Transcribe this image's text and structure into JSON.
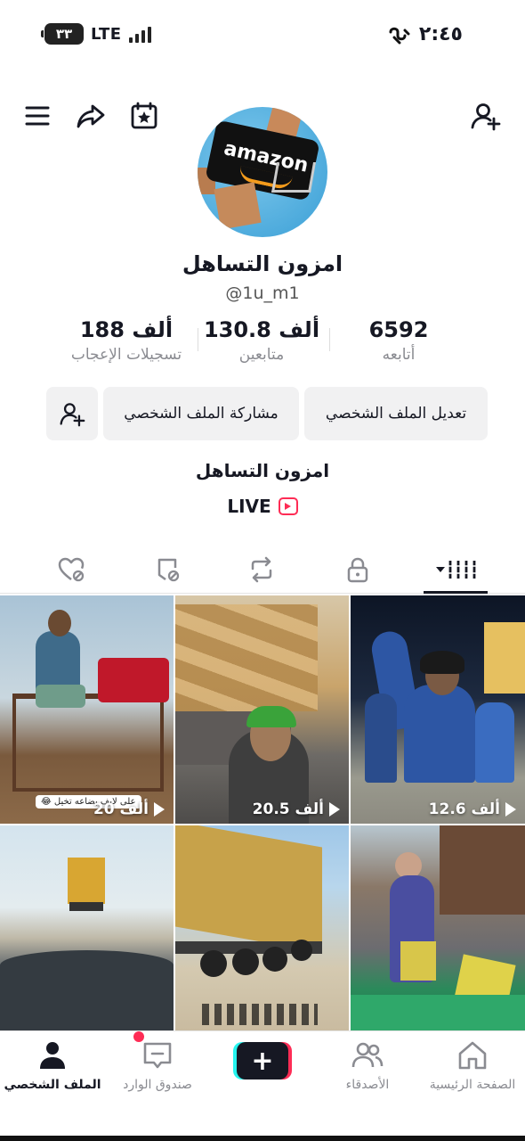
{
  "status_bar": {
    "battery": "٣٣",
    "network": "LTE",
    "time": "٢:٤٥"
  },
  "top_nav": {
    "icons": [
      "menu-icon",
      "share-arrow-icon",
      "calendar-star-icon",
      "add-user-icon"
    ]
  },
  "profile": {
    "avatar_text": "amazon",
    "display_name": "امزون التساهل",
    "username": "@1u_m1",
    "bio": "امزون التساهل",
    "live_label": "LIVE"
  },
  "stats": {
    "following": {
      "value": "6592",
      "label": "أتابعه"
    },
    "followers": {
      "value": "130.8 ألف",
      "label": "متابعين"
    },
    "likes": {
      "value": "188 ألف",
      "label": "تسجيلات الإعجاب"
    }
  },
  "buttons": {
    "edit_profile": "تعديل الملف الشخصي",
    "share_profile": "مشاركة الملف الشخصي"
  },
  "tabs": [
    {
      "name": "videos",
      "icon": "grid-bars-icon",
      "active": true
    },
    {
      "name": "private",
      "icon": "lock-icon",
      "active": false
    },
    {
      "name": "reposts",
      "icon": "repost-icon",
      "active": false
    },
    {
      "name": "favorites",
      "icon": "bookmark-hidden-icon",
      "active": false
    },
    {
      "name": "liked",
      "icon": "heart-hidden-icon",
      "active": false
    }
  ],
  "videos": [
    {
      "views": "20 ألف",
      "caption": "😂 على لايف بضاعه تخيل",
      "colors": [
        "#a9c3d6",
        "#7a5a3d"
      ]
    },
    {
      "views": "20.5 ألف",
      "colors": [
        "#c9a46b",
        "#6d6a66"
      ]
    },
    {
      "views": "12.6 ألف",
      "colors": [
        "#0d1525",
        "#2d56a4"
      ]
    },
    {
      "views": "",
      "colors": [
        "#d4e4ee",
        "#4b5158"
      ]
    },
    {
      "views": "",
      "colors": [
        "#9fc7e8",
        "#c7a24a"
      ]
    },
    {
      "views": "",
      "colors": [
        "#b7c6cf",
        "#2a8a5a"
      ]
    }
  ],
  "bottom_nav": {
    "home": "الصفحة الرئيسية",
    "friends": "الأصدقاء",
    "create": "+",
    "inbox": "صندوق الوارد",
    "profile": "الملف الشخصي"
  },
  "colors": {
    "accent_red": "#fe2c55",
    "accent_cyan": "#25f4ee",
    "text_primary": "#161823",
    "text_secondary": "#8a8b91"
  }
}
